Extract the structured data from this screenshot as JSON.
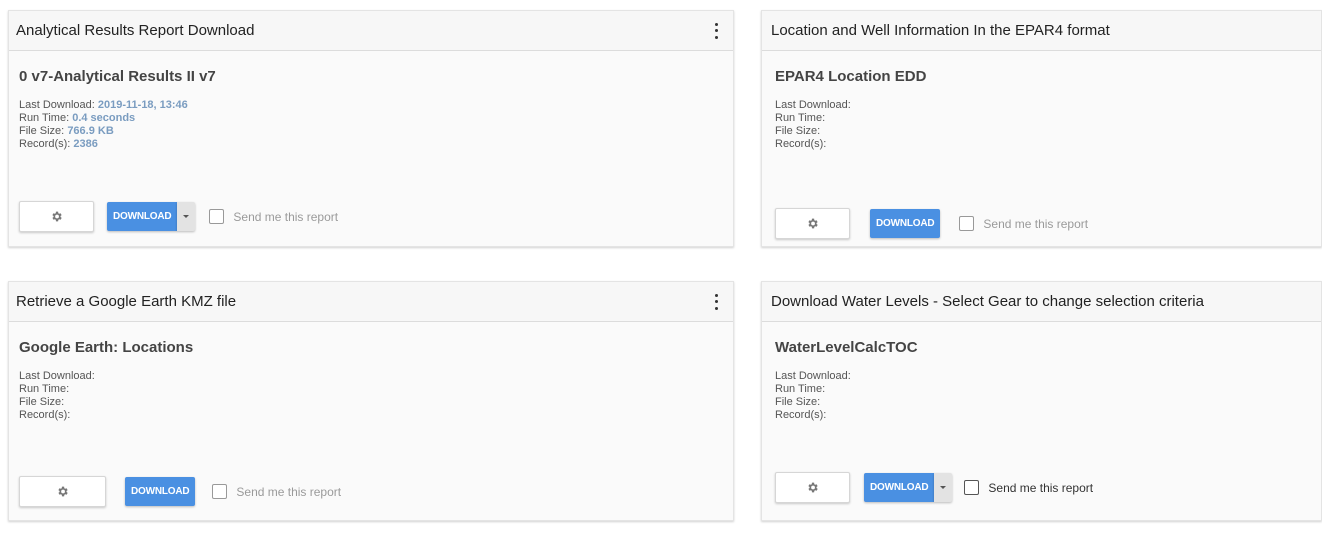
{
  "cards": [
    {
      "header": "Analytical Results Report Download",
      "report_name": "0 v7-Analytical Results II v7",
      "last_download_label": "Last Download:",
      "last_download_value": "2019-11-18, 13:46",
      "run_time_label": "Run Time:",
      "run_time_value": "0.4 seconds",
      "file_size_label": "File Size:",
      "file_size_value": "766.9 KB",
      "records_label": "Record(s):",
      "records_value": "2386",
      "download_label": "DOWNLOAD",
      "send_label": "Send me this report"
    },
    {
      "header": "Location and Well Information In the EPAR4 format",
      "report_name": "EPAR4 Location EDD",
      "last_download_label": "Last Download:",
      "run_time_label": "Run Time:",
      "file_size_label": "File Size:",
      "records_label": "Record(s):",
      "download_label": "DOWNLOAD",
      "send_label": "Send me this report"
    },
    {
      "header": "Retrieve a Google Earth KMZ file",
      "report_name": "Google Earth: Locations",
      "last_download_label": "Last Download:",
      "run_time_label": "Run Time:",
      "file_size_label": "File Size:",
      "records_label": "Record(s):",
      "download_label": "DOWNLOAD",
      "send_label": "Send me this report"
    },
    {
      "header": "Download Water Levels - Select Gear to change selection criteria",
      "report_name": "WaterLevelCalcTOC",
      "last_download_label": "Last Download:",
      "run_time_label": "Run Time:",
      "file_size_label": "File Size:",
      "records_label": "Record(s):",
      "download_label": "DOWNLOAD",
      "send_label": "Send me this report"
    }
  ],
  "icons": {
    "menu": "more-vertical-icon",
    "settings": "gear-icon",
    "dropdown": "caret-down-icon",
    "checkbox": "checkbox-unchecked-icon"
  },
  "colors": {
    "download_button": "#4a90e2",
    "meta_value": "#7a9cc0"
  }
}
